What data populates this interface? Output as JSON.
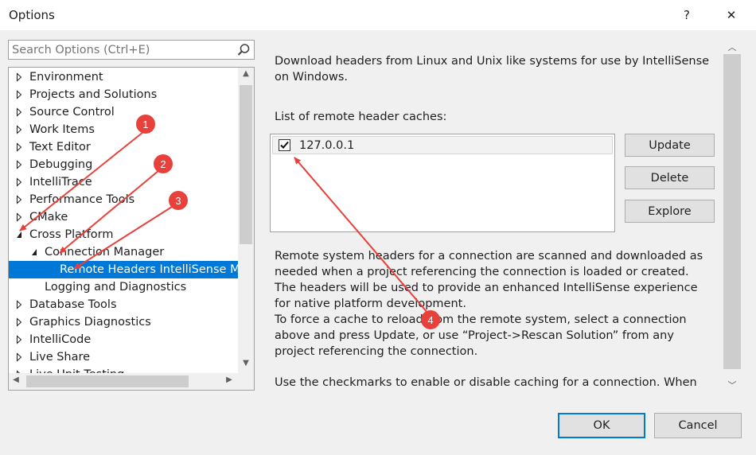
{
  "window": {
    "title": "Options",
    "help_glyph": "?",
    "close_glyph": "✕"
  },
  "search": {
    "placeholder": "Search Options (Ctrl+E)"
  },
  "tree": {
    "items": [
      {
        "label": "Environment",
        "level": 0,
        "state": "collapsed"
      },
      {
        "label": "Projects and Solutions",
        "level": 0,
        "state": "collapsed"
      },
      {
        "label": "Source Control",
        "level": 0,
        "state": "collapsed"
      },
      {
        "label": "Work Items",
        "level": 0,
        "state": "collapsed"
      },
      {
        "label": "Text Editor",
        "level": 0,
        "state": "collapsed"
      },
      {
        "label": "Debugging",
        "level": 0,
        "state": "collapsed"
      },
      {
        "label": "IntelliTrace",
        "level": 0,
        "state": "collapsed"
      },
      {
        "label": "Performance Tools",
        "level": 0,
        "state": "collapsed"
      },
      {
        "label": "CMake",
        "level": 0,
        "state": "collapsed"
      },
      {
        "label": "Cross Platform",
        "level": 0,
        "state": "expanded"
      },
      {
        "label": "Connection Manager",
        "level": 1,
        "state": "expanded"
      },
      {
        "label": "Remote Headers IntelliSense Manager",
        "level": 2,
        "state": "leaf",
        "selected": true
      },
      {
        "label": "Logging and Diagnostics",
        "level": 1,
        "state": "leaf"
      },
      {
        "label": "Database Tools",
        "level": 0,
        "state": "collapsed"
      },
      {
        "label": "Graphics Diagnostics",
        "level": 0,
        "state": "collapsed"
      },
      {
        "label": "IntelliCode",
        "level": 0,
        "state": "collapsed"
      },
      {
        "label": "Live Share",
        "level": 0,
        "state": "collapsed"
      },
      {
        "label": "Live Unit Testing",
        "level": 0,
        "state": "collapsed"
      }
    ]
  },
  "content": {
    "intro_line1": "Download headers from Linux and Unix like systems for use by IntelliSense",
    "intro_line2": "on Windows.",
    "list_label": "List of remote header caches:",
    "caches": [
      {
        "name": "127.0.0.1",
        "checked": true
      }
    ],
    "buttons": {
      "update": "Update",
      "delete": "Delete",
      "explore": "Explore"
    },
    "desc_lines": [
      "Remote system headers for a connection are scanned and downloaded as",
      "needed when a project referencing the connection is loaded or created.",
      "The headers will be used to provide an enhanced IntelliSense experience",
      "for native platform development.",
      "To force a cache to reload from the remote system, select a connection",
      "above and press Update, or use “Project->Rescan Solution” from any",
      "project referencing the connection."
    ],
    "checkmarks_line": "Use the checkmarks to enable or disable caching for a connection. When"
  },
  "footer": {
    "ok": "OK",
    "cancel": "Cancel"
  },
  "annotations": [
    {
      "number": "1"
    },
    {
      "number": "2"
    },
    {
      "number": "3"
    },
    {
      "number": "4"
    }
  ],
  "colors": {
    "selection": "#0078d7",
    "annotation": "#e8403a"
  }
}
